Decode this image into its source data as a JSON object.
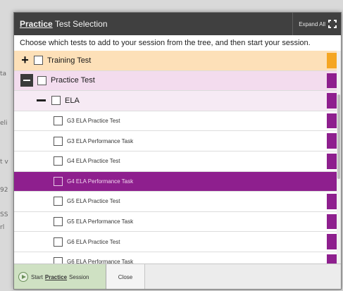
{
  "header": {
    "title_emphasis": "Practice",
    "title_rest": " Test Selection",
    "expand_all_label": "Expand All",
    "expand_icon": "expand-corners-icon"
  },
  "instructions": "Choose which tests to add to your session from the tree, and then start your session.",
  "tree": {
    "training": {
      "label": "Training Test",
      "toggle": "+"
    },
    "practice": {
      "label": "Practice Test"
    },
    "ela": {
      "label": "ELA"
    },
    "tests": [
      {
        "label": "G3 ELA Practice Test",
        "selected": false
      },
      {
        "label": "G3 ELA Performance Task",
        "selected": false
      },
      {
        "label": "G4 ELA Practice Test",
        "selected": false
      },
      {
        "label": "G4 ELA Performance Task",
        "selected": true
      },
      {
        "label": "G5 ELA Practice Test",
        "selected": false
      },
      {
        "label": "G5 ELA Performance Task",
        "selected": false
      },
      {
        "label": "G6 ELA Practice Test",
        "selected": false
      },
      {
        "label": "G6 ELA Performance Task",
        "selected": false
      }
    ]
  },
  "footer": {
    "start_prefix": "Start",
    "start_emphasis": "Practice",
    "start_suffix": "Session",
    "close_label": "Close"
  },
  "colors": {
    "training_accent": "#f5a623",
    "practice_accent": "#8e1f8e",
    "header_bg": "#404040",
    "start_button_bg": "#cfe1c3"
  }
}
